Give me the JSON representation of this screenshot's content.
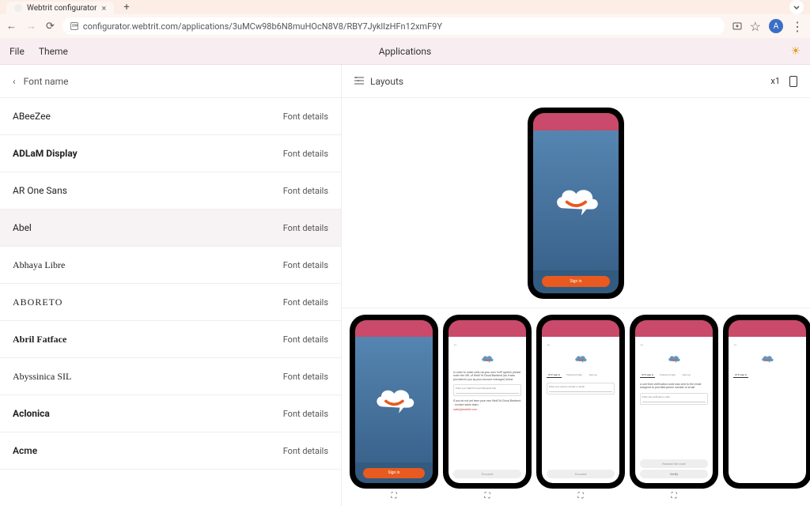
{
  "browser": {
    "tab_title": "Webtrit configurator",
    "url": "configurator.webtrit.com/applications/3uMCw98b6N8muHOcN8V8/RBY7JyklIzHFn12xmF9Y"
  },
  "app": {
    "menu": {
      "file": "File",
      "theme": "Theme"
    },
    "title": "Applications",
    "avatar_initial": "A"
  },
  "left": {
    "back_label": "Font name",
    "details_label": "Font details",
    "fonts": [
      "ABeeZee",
      "ADLaM Display",
      "AR One Sans",
      "Abel",
      "Abhaya Libre",
      "ABORETO",
      "Abril Fatface",
      "Abyssinica SIL",
      "Aclonica",
      "Acme"
    ]
  },
  "right": {
    "header": "Layouts",
    "zoom": "x1"
  },
  "screens": {
    "signin_btn": "Sign in",
    "s2_text": "In order to make calls via your own VoIP system please enter the URL of WebTrit Cloud Backend (as it was provided to you by your account manager) below",
    "s2_input_label": "Enter your WebTrit Cloud Backend URL",
    "s2_footer": "If you do not yet have your own WebTrit Cloud Backend - contact sales team",
    "s2_link": "sales@webtrit.com",
    "s2_btn": "Proceed",
    "tabs_otp": "OTP sign in",
    "tabs_pwd": "Password sign-",
    "tabs_signup": "Sign up",
    "s3_input_label": "Enter your phone number or email",
    "s4_text": "A one-time verification code was sent to the email assigned to provided phone number or email",
    "s4_input_label": "Enter the verification code",
    "s4_btn1": "Resend the code",
    "s4_btn2": "Verify"
  }
}
